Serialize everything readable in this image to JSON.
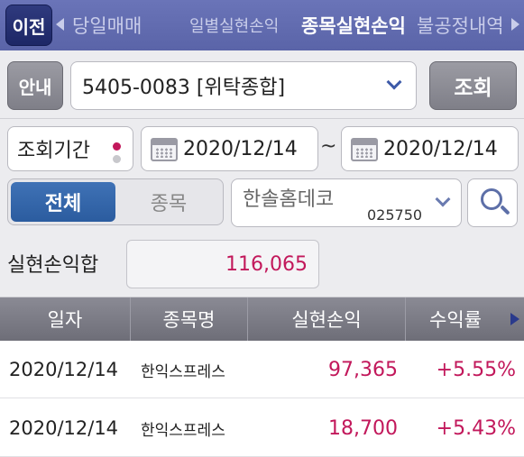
{
  "nav": {
    "back_label": "이전",
    "tabs": [
      {
        "label": "당일매매",
        "active": false
      },
      {
        "label": "일별실현손익",
        "active": false
      },
      {
        "label": "종목실현손익",
        "active": true
      },
      {
        "label": "불공정내역",
        "active": false
      }
    ]
  },
  "account": {
    "info_label": "안내",
    "account_value": "5405-0083 [위탁종합]",
    "query_label": "조회"
  },
  "period": {
    "label": "조회기간",
    "start_date": "2020/12/14",
    "separator": "~",
    "end_date": "2020/12/14"
  },
  "filter": {
    "all_label": "전체",
    "stock_label": "종목",
    "stock_name": "한솔홈데코",
    "stock_code": "025750"
  },
  "summary": {
    "label": "실현손익합",
    "value": "116,065"
  },
  "table": {
    "headers": [
      "일자",
      "종목명",
      "실현손익",
      "수익률"
    ],
    "rows": [
      {
        "date": "2020/12/14",
        "name": "한익스프레스",
        "profit": "97,365",
        "rate": "+5.55%"
      },
      {
        "date": "2020/12/14",
        "name": "한익스프레스",
        "profit": "18,700",
        "rate": "+5.43%"
      }
    ]
  },
  "colors": {
    "nav_bg": "#6a74b8",
    "accent_blue": "#2b5c9f",
    "profit_red": "#c2185b"
  }
}
